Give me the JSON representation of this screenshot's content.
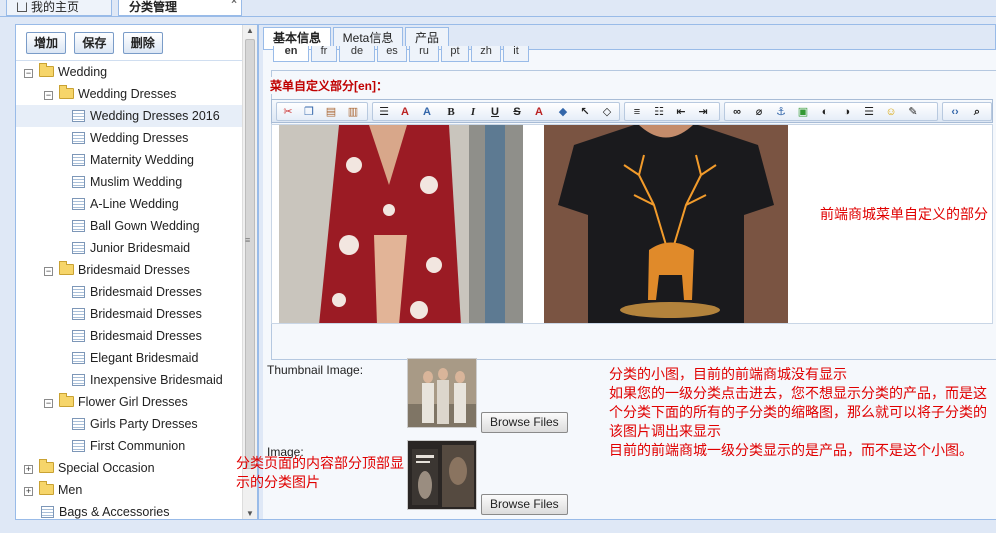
{
  "top_tabs": [
    {
      "label": "我的主页"
    },
    {
      "label": "分类管理"
    }
  ],
  "toolbar_buttons": {
    "add": "增加",
    "save": "保存",
    "delete": "删除"
  },
  "tree": [
    {
      "label": "Wedding",
      "level": 0,
      "type": "folder",
      "expanded": true
    },
    {
      "label": "Wedding Dresses",
      "level": 1,
      "type": "folder",
      "expanded": true
    },
    {
      "label": "Wedding Dresses 2016",
      "level": 2,
      "type": "leaf",
      "selected": true
    },
    {
      "label": "Wedding Dresses",
      "level": 2,
      "type": "leaf"
    },
    {
      "label": "Maternity Wedding",
      "level": 2,
      "type": "leaf"
    },
    {
      "label": "Muslim Wedding",
      "level": 2,
      "type": "leaf"
    },
    {
      "label": "A-Line Wedding",
      "level": 2,
      "type": "leaf"
    },
    {
      "label": "Ball Gown Wedding",
      "level": 2,
      "type": "leaf"
    },
    {
      "label": "Junior Bridesmaid",
      "level": 2,
      "type": "leaf"
    },
    {
      "label": "Bridesmaid Dresses",
      "level": 1,
      "type": "folder",
      "expanded": true
    },
    {
      "label": "Bridesmaid Dresses",
      "level": 2,
      "type": "leaf"
    },
    {
      "label": "Bridesmaid Dresses",
      "level": 2,
      "type": "leaf"
    },
    {
      "label": "Bridesmaid Dresses",
      "level": 2,
      "type": "leaf"
    },
    {
      "label": "Elegant Bridesmaid",
      "level": 2,
      "type": "leaf"
    },
    {
      "label": "Inexpensive Bridesmaid",
      "level": 2,
      "type": "leaf"
    },
    {
      "label": "Flower Girl Dresses",
      "level": 1,
      "type": "folder",
      "expanded": true
    },
    {
      "label": "Girls Party Dresses",
      "level": 2,
      "type": "leaf"
    },
    {
      "label": "First Communion",
      "level": 2,
      "type": "leaf"
    },
    {
      "label": "Special Occasion",
      "level": 0,
      "type": "folder",
      "expanded": false
    },
    {
      "label": "Men",
      "level": 0,
      "type": "folder",
      "expanded": false
    },
    {
      "label": "Bags & Accessories",
      "level": 0,
      "type": "leaf"
    }
  ],
  "right_tabs": [
    {
      "label": "基本信息",
      "active": true
    },
    {
      "label": "Meta信息"
    },
    {
      "label": "产品"
    }
  ],
  "lang_tabs": [
    {
      "label": "en",
      "active": true
    },
    {
      "label": "fr"
    },
    {
      "label": "de"
    },
    {
      "label": "es"
    },
    {
      "label": "ru"
    },
    {
      "label": "pt"
    },
    {
      "label": "zh"
    },
    {
      "label": "it"
    }
  ],
  "editor_legend": "菜单自定义部分[en]：",
  "notes": {
    "menu_custom": "前端商城菜单自定义的部分",
    "thumbnail_note": "分类的小图，目前的前端商城没有显示\n如果您的一级分类点击进去，您不想显示分类的产品，而是这个分类下面的所有的子分类的缩略图，那么就可以将子分类的该图片调出来显示\n目前的前端商城一级分类显示的是产品，而不是这个小图。",
    "image_note": "分类页面的内容部分顶部显示的分类图片"
  },
  "fields": {
    "thumbnail_label": "Thumbnail Image:",
    "image_label": "Image:",
    "browse_label": "Browse Files"
  },
  "colors": {
    "accent_border": "#99bbe8",
    "note_red": "#e00000",
    "legend_red": "#c00000"
  }
}
